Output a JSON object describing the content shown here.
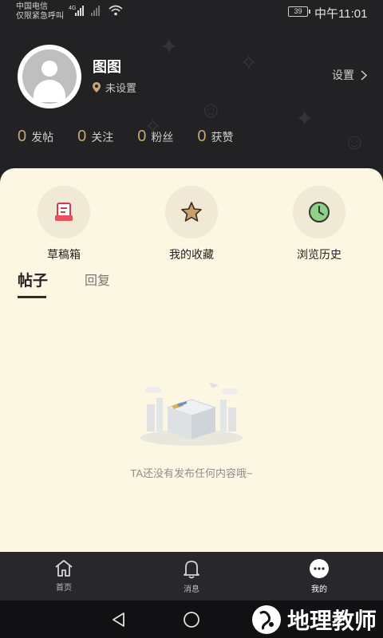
{
  "status": {
    "carrier_line1": "中国电信",
    "carrier_line2": "仅限紧急呼叫",
    "network": "4G",
    "battery": "39",
    "time": "中午11:01"
  },
  "profile": {
    "username": "图图",
    "location": "未设置",
    "settings_label": "设置",
    "stats": [
      {
        "value": "0",
        "label": "发帖"
      },
      {
        "value": "0",
        "label": "关注"
      },
      {
        "value": "0",
        "label": "粉丝"
      },
      {
        "value": "0",
        "label": "获赞"
      }
    ]
  },
  "quick_actions": [
    {
      "label": "草稿箱",
      "icon": "draft-box-icon"
    },
    {
      "label": "我的收藏",
      "icon": "star-icon"
    },
    {
      "label": "浏览历史",
      "icon": "clock-icon"
    }
  ],
  "tabs": [
    {
      "label": "帖子",
      "active": true
    },
    {
      "label": "回复",
      "active": false
    }
  ],
  "empty_state": {
    "text": "TA还没有发布任何内容哦~"
  },
  "bottom_nav": [
    {
      "label": "首页",
      "icon": "home-icon"
    },
    {
      "label": "消息",
      "icon": "bell-icon"
    },
    {
      "label": "我的",
      "icon": "profile-bubble-icon",
      "active": true
    }
  ],
  "watermark": "地理教师",
  "colors": {
    "accent": "#c7a671",
    "header_bg": "#222225",
    "card_bg": "#fcf7e2"
  }
}
